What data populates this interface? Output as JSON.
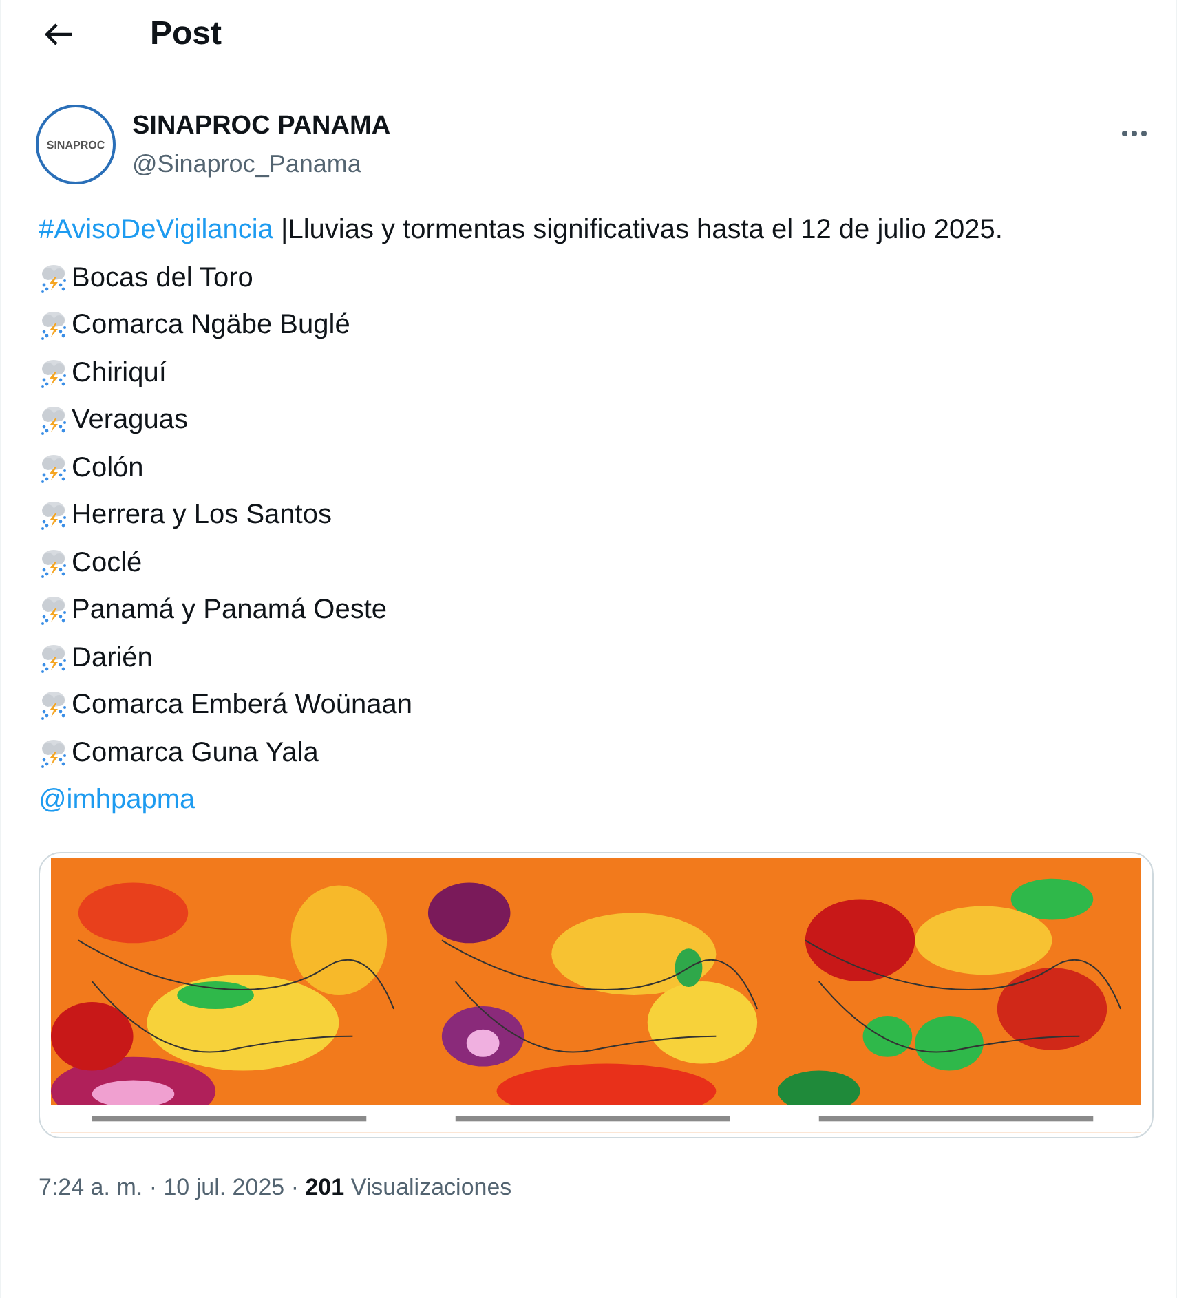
{
  "header": {
    "title": "Post"
  },
  "author": {
    "name": "SINAPROC PANAMA",
    "handle": "@Sinaproc_Panama",
    "avatar_text": "SINAPROC"
  },
  "post": {
    "hashtag": "#AvisoDeVigilancia",
    "text": " |Lluvias y tormentas significativas hasta el 12 de julio 2025.",
    "regions": [
      "Bocas del Toro",
      "Comarca Ngäbe Buglé",
      "Chiriquí",
      "Veraguas",
      "Colón",
      "Herrera y Los Santos",
      "Coclé",
      "Panamá y Panamá Oeste",
      "Darién",
      "Comarca Emberá Woünaan",
      "Comarca Guna Yala"
    ],
    "mention": "@imhpapma"
  },
  "meta": "7:24 a. m. · 10 jul. 2025 · **201** Visualizaciones"
}
